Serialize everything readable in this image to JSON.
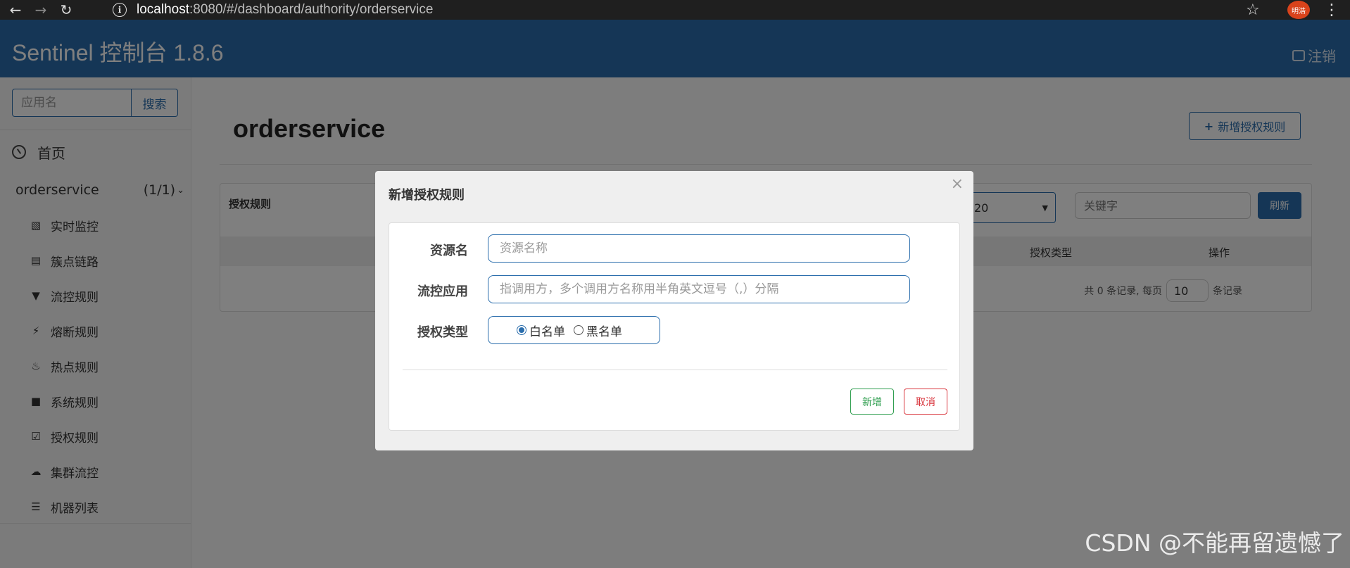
{
  "browser": {
    "url_host": "localhost",
    "url_rest": ":8080/#/dashboard/authority/orderservice",
    "avatar_text": "明浩"
  },
  "header": {
    "title": "Sentinel 控制台 1.8.6",
    "logout_label": "注销"
  },
  "sidebar": {
    "search_placeholder": "应用名",
    "search_button": "搜索",
    "home_label": "首页",
    "app_name": "orderservice",
    "app_count": "(1/1)",
    "items": [
      {
        "label": "实时监控",
        "icon": "bar-chart-icon"
      },
      {
        "label": "簇点链路",
        "icon": "list-alt-icon"
      },
      {
        "label": "流控规则",
        "icon": "filter-icon"
      },
      {
        "label": "熔断规则",
        "icon": "flash-icon"
      },
      {
        "label": "热点规则",
        "icon": "fire-icon"
      },
      {
        "label": "系统规则",
        "icon": "lock-icon"
      },
      {
        "label": "授权规则",
        "icon": "check-icon"
      },
      {
        "label": "集群流控",
        "icon": "cloud-icon"
      },
      {
        "label": "机器列表",
        "icon": "th-list-icon"
      }
    ]
  },
  "main": {
    "title": "orderservice",
    "add_button": "新增授权规则",
    "panel_title": "授权规则",
    "select_value": "20",
    "keyword_placeholder": "关键字",
    "refresh_button": "刷新",
    "columns": [
      "授权类型",
      "操作"
    ],
    "pager_prefix": "共 0 条记录, 每页",
    "page_size": "10",
    "pager_suffix": "条记录"
  },
  "modal": {
    "title": "新增授权规则",
    "close": "×",
    "resource_label": "资源名",
    "resource_placeholder": "资源名称",
    "limit_app_label": "流控应用",
    "limit_app_placeholder": "指调用方，多个调用方名称用半角英文逗号（,）分隔",
    "strategy_label": "授权类型",
    "strategy_options": [
      "白名单",
      "黑名单"
    ],
    "strategy_selected": "白名单",
    "add_button": "新增",
    "cancel_button": "取消"
  },
  "watermark": "CSDN @不能再留遗憾了",
  "colors": {
    "primary": "#2a6dac",
    "success": "#2f9e4f",
    "danger": "#d9363e"
  }
}
